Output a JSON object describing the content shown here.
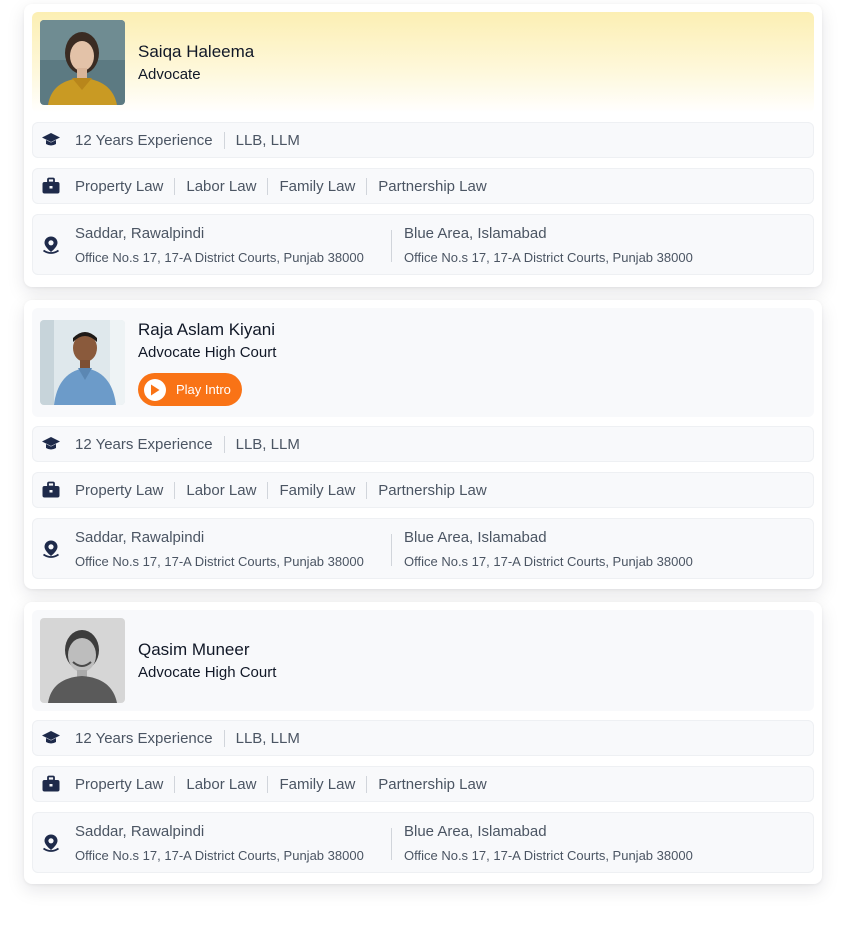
{
  "lawyers": [
    {
      "name": "Saiqa Haleema",
      "title": "Advocate",
      "experience": "12 Years Experience",
      "degrees": "LLB, LLM",
      "practice_areas": [
        "Property Law",
        "Labor Law",
        "Family Law",
        "Partnership Law"
      ],
      "offices": [
        {
          "city": "Saddar, Rawalpindi",
          "address": "Office No.s 17, 17-A District Courts, Punjab 38000"
        },
        {
          "city": "Blue Area, Islamabad",
          "address": "Office No.s 17, 17-A District Courts, Punjab 38000"
        }
      ]
    },
    {
      "name": "Raja Aslam Kiyani",
      "title": "Advocate High Court",
      "play_label": "Play Intro",
      "experience": "12 Years Experience",
      "degrees": "LLB, LLM",
      "practice_areas": [
        "Property Law",
        "Labor Law",
        "Family Law",
        "Partnership Law"
      ],
      "offices": [
        {
          "city": "Saddar, Rawalpindi",
          "address": "Office No.s 17, 17-A District Courts, Punjab 38000"
        },
        {
          "city": "Blue Area, Islamabad",
          "address": "Office No.s 17, 17-A District Courts, Punjab 38000"
        }
      ]
    },
    {
      "name": "Qasim Muneer",
      "title": "Advocate High Court",
      "experience": "12 Years Experience",
      "degrees": "LLB, LLM",
      "practice_areas": [
        "Property Law",
        "Labor Law",
        "Family Law",
        "Partnership Law"
      ],
      "offices": [
        {
          "city": "Saddar, Rawalpindi",
          "address": "Office No.s 17, 17-A District Courts, Punjab 38000"
        },
        {
          "city": "Blue Area, Islamabad",
          "address": "Office No.s 17, 17-A District Courts, Punjab 38000"
        }
      ]
    }
  ],
  "icons": {
    "education": "graduation-cap-icon",
    "practice": "briefcase-icon",
    "location": "map-pin-icon",
    "play": "play-icon"
  },
  "colors": {
    "accent": "#f97316",
    "icon": "#1e2a4a",
    "featured_bg": "#fcefb3"
  }
}
